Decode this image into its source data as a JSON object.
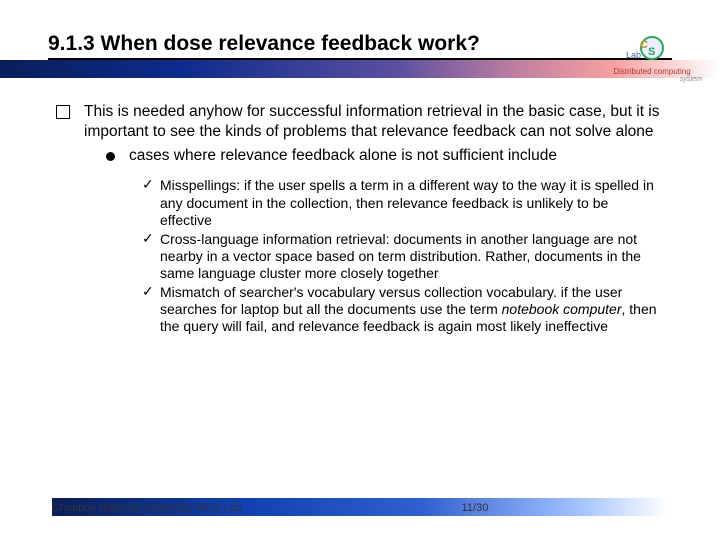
{
  "title": "9.1.3 When dose relevance feedback work?",
  "logo": {
    "name": "DCS Lab",
    "line1": "Distributed computing",
    "line2": "system"
  },
  "content": {
    "main": "This is needed anyhow for successful information retrieval in the basic case, but it is important to see the kinds of problems that relevance feedback can not solve alone",
    "sub": "cases where relevance feedback alone is not sufficient include",
    "items": [
      {
        "lead": "Misspellings:",
        "rest": " if the user spells a term in a different way to the way it is spelled in any document in the collection, then relevance feedback is unlikely to be effective"
      },
      {
        "lead": "Cross-language information retrieval:",
        "rest": " documents in another language are not nearby in a vector space based on term distribution. Rather, documents in the same language cluster more closely together"
      },
      {
        "lead": "Mismatch of searcher's vocabulary versus collection vocabulary.",
        "rest": " if the user searches for laptop but all the documents use the term ",
        "italic": "notebook computer",
        "tail": ", then the query will fail, and relevance feedback is again most likely ineffective"
      }
    ]
  },
  "footer": {
    "affiliation": "Chonbuk National University, MCS Lab",
    "page": "11/30"
  }
}
